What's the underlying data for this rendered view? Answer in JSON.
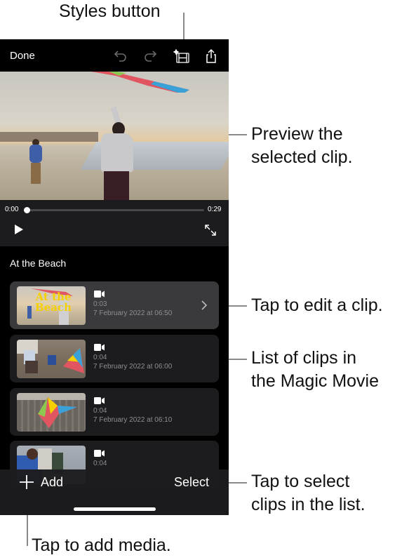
{
  "callouts": {
    "styles_button": "Styles button",
    "preview": "Preview the\nselected clip.",
    "edit_clip": "Tap to edit a clip.",
    "list_of_clips": "List of clips in\nthe Magic Movie",
    "select_clips": "Tap to select\nclips in the list.",
    "add_media": "Tap to add media."
  },
  "topbar": {
    "done_label": "Done",
    "icons": [
      "undo-icon",
      "redo-icon",
      "styles-icon",
      "share-icon"
    ]
  },
  "player": {
    "current_time": "0:00",
    "total_time": "0:29",
    "progress": 0.0
  },
  "section_title": "At the Beach",
  "clips": [
    {
      "thumb_title": "At the Beach",
      "duration": "0:03",
      "date": "7 February 2022  at 06:50",
      "selected": true
    },
    {
      "duration": "0:04",
      "date": "7 February 2022  at 06:00",
      "selected": false
    },
    {
      "duration": "0:04",
      "date": "7 February 2022  at 06:10",
      "selected": false
    },
    {
      "duration": "0:04",
      "date": "",
      "selected": false
    }
  ],
  "bottombar": {
    "add_label": "Add",
    "select_label": "Select"
  },
  "colors": {
    "background": "#000000",
    "panel": "#1c1c1e",
    "selected_clip": "#3a3a3c",
    "secondary_text": "#8e8e93",
    "title_yellow": "#f5d000"
  }
}
